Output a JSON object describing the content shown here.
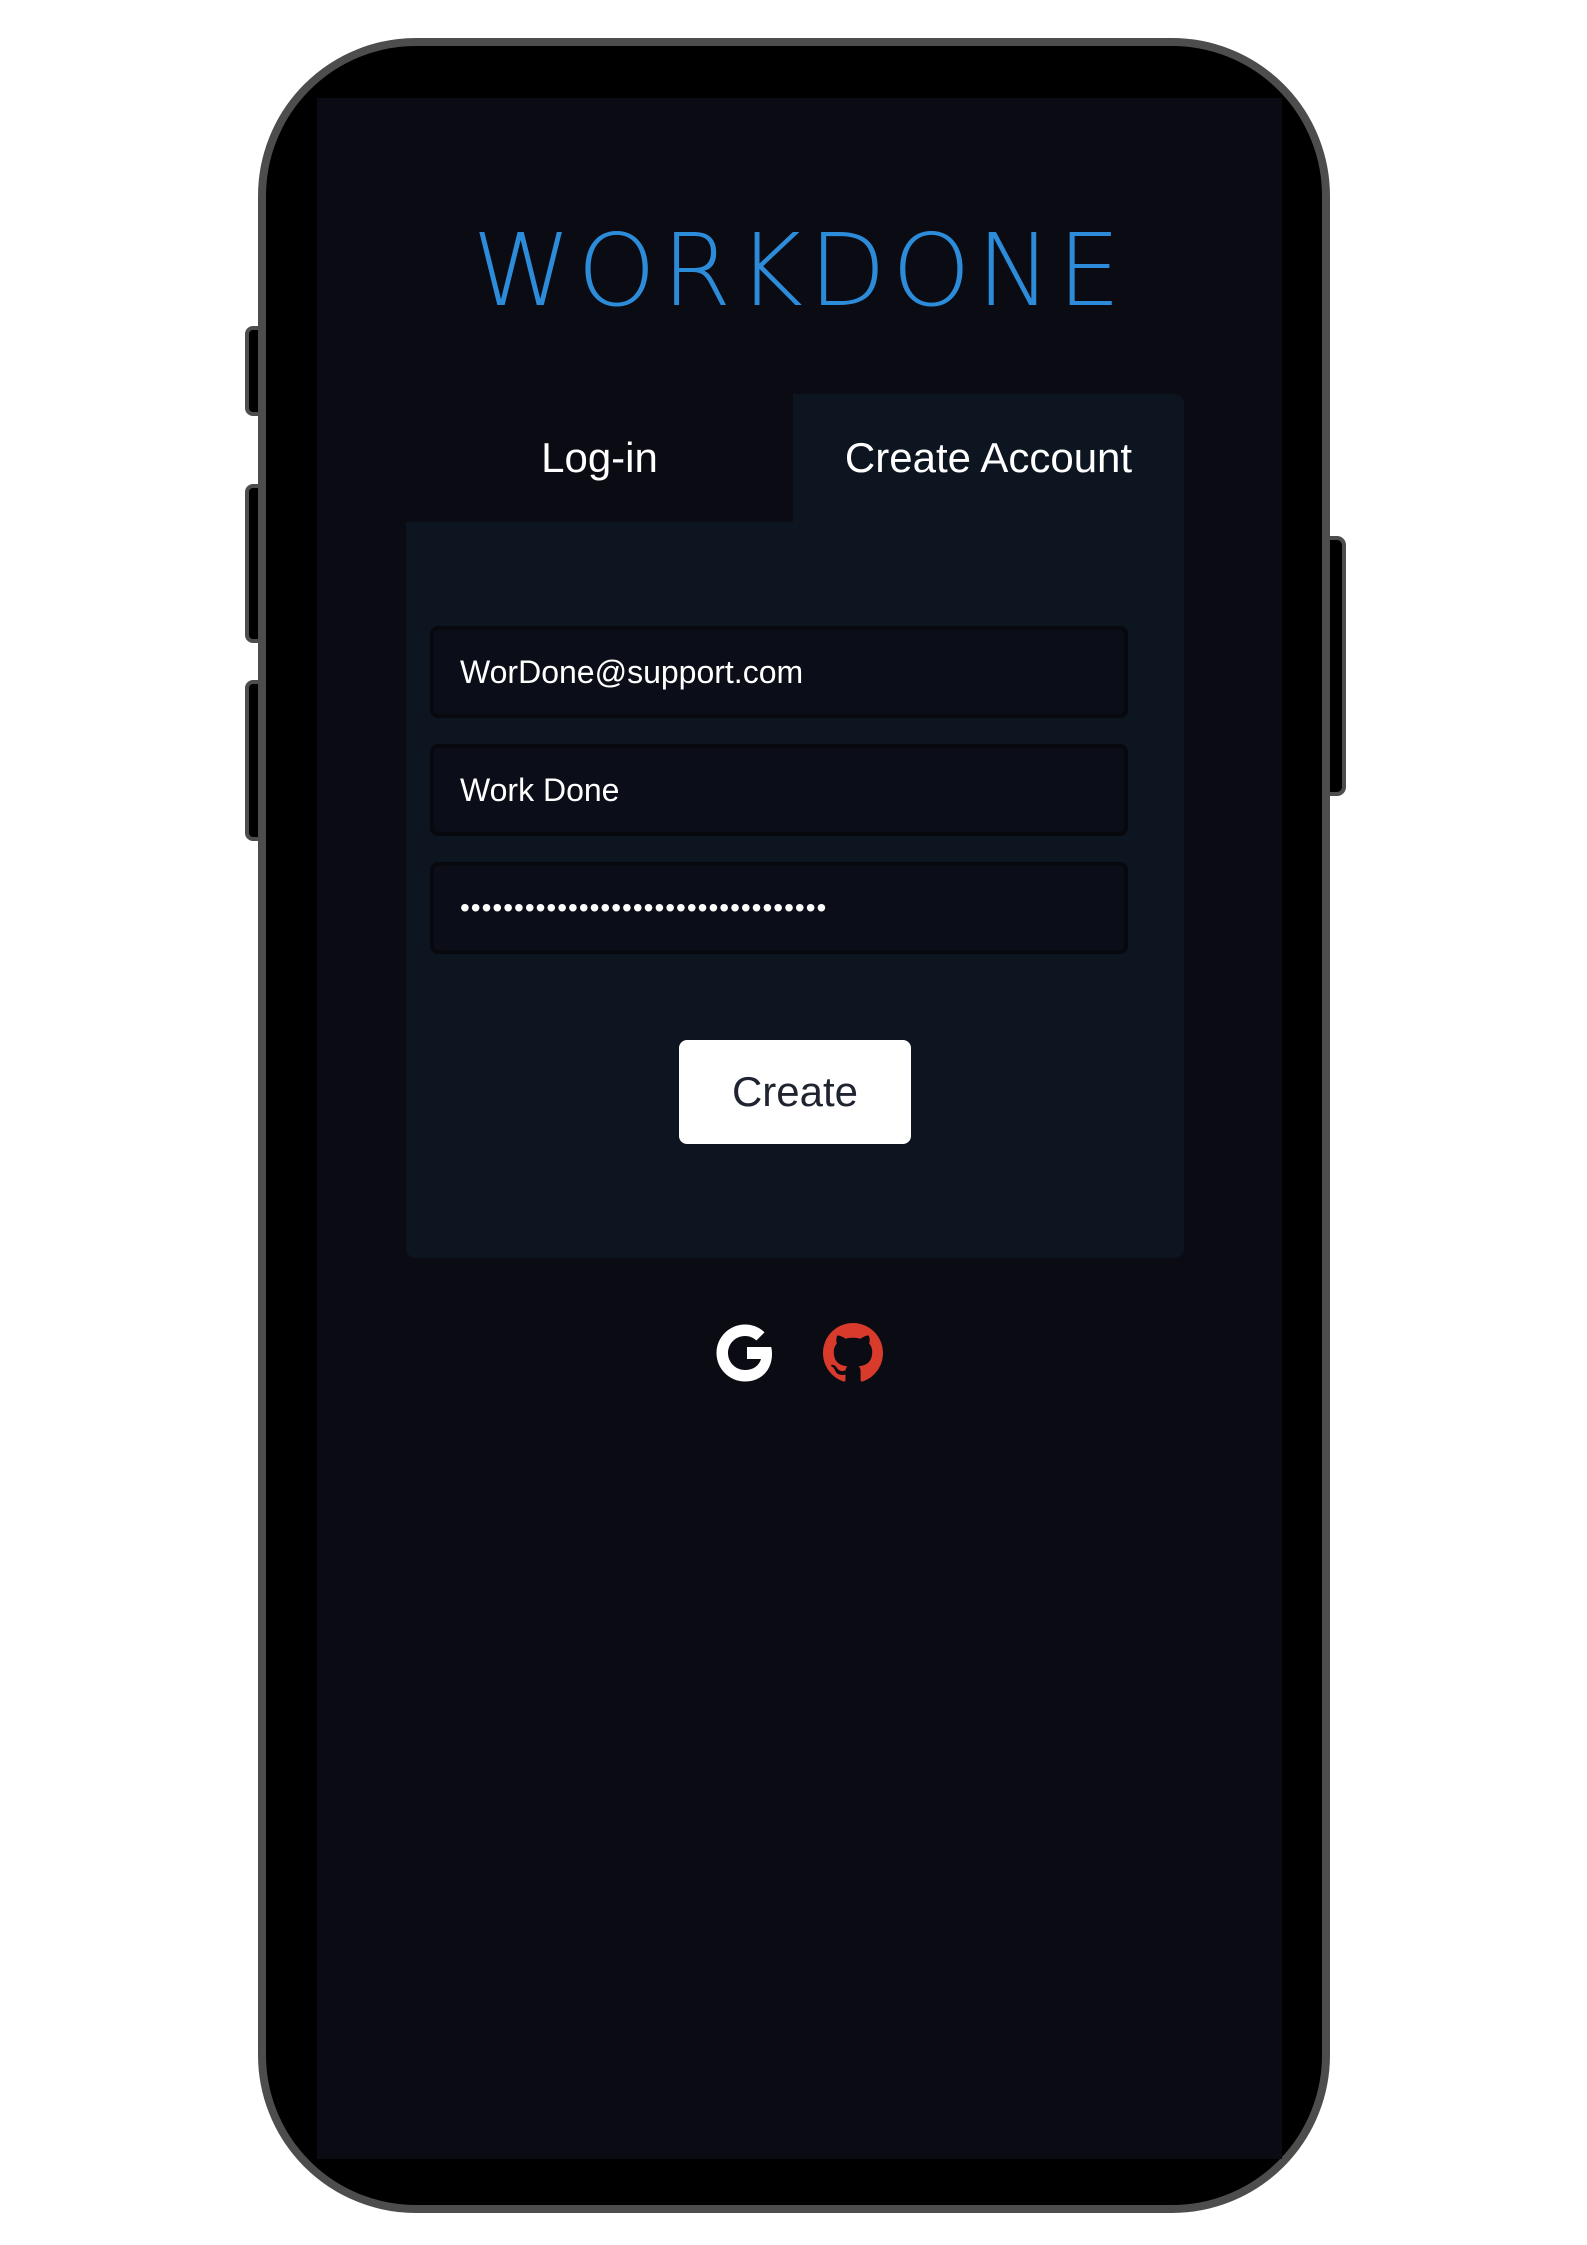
{
  "app": {
    "logo_text": "WORKDONE"
  },
  "tabs": {
    "login_label": "Log-in",
    "create_label": "Create Account",
    "active": "Create Account"
  },
  "form": {
    "email_value": "WorDone@support.com",
    "name_value": "Work Done",
    "password_masked": "••••••••••••••••••••••••••••••••••",
    "create_label": "Create"
  },
  "social": {
    "google_icon": "google-icon",
    "github_icon": "github-icon"
  },
  "colors": {
    "accent": "#2d8cda",
    "github": "#d83a2b",
    "screen_bg": "#0b0b14",
    "card_bg": "#0d1520"
  }
}
